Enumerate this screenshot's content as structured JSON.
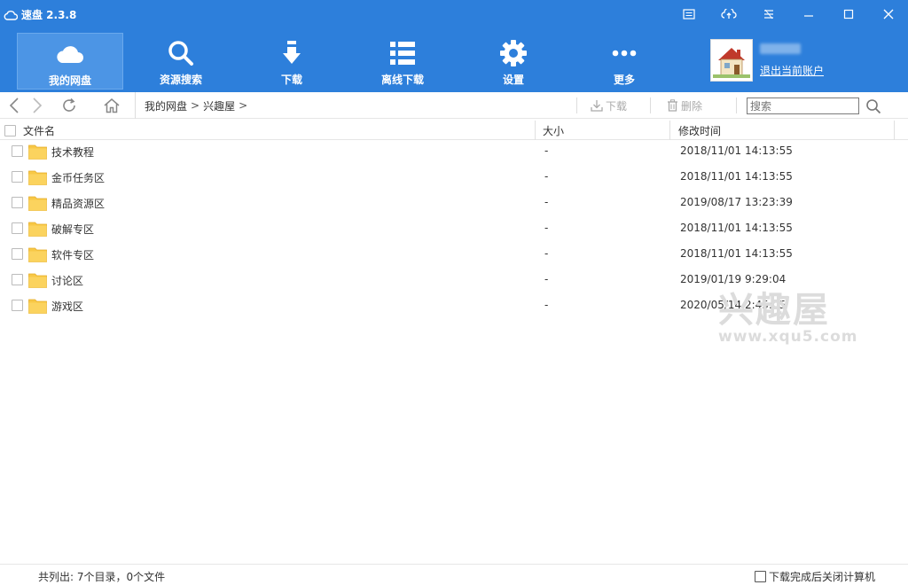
{
  "window": {
    "title": "速盘 2.3.8"
  },
  "nav": {
    "items": [
      {
        "label": "我的网盘",
        "icon": "cloud-icon",
        "active": true
      },
      {
        "label": "资源搜索",
        "icon": "search-icon",
        "active": false
      },
      {
        "label": "下载",
        "icon": "download-arrow-icon",
        "active": false
      },
      {
        "label": "离线下载",
        "icon": "list-icon",
        "active": false
      },
      {
        "label": "设置",
        "icon": "gear-icon",
        "active": false
      },
      {
        "label": "更多",
        "icon": "more-dots-icon",
        "active": false
      }
    ],
    "user": {
      "logout_label": "退出当前账户"
    }
  },
  "toolbar": {
    "breadcrumb": [
      "我的网盘",
      "兴趣屋"
    ],
    "breadcrumb_sep": ">",
    "download_label": "下载",
    "delete_label": "删除",
    "search_placeholder": "搜索"
  },
  "table": {
    "headers": {
      "name": "文件名",
      "size": "大小",
      "modified": "修改时间"
    },
    "rows": [
      {
        "name": "技术教程",
        "size": "-",
        "modified": "2018/11/01 14:13:55"
      },
      {
        "name": "金币任务区",
        "size": "-",
        "modified": "2018/11/01 14:13:55"
      },
      {
        "name": "精品资源区",
        "size": "-",
        "modified": "2019/08/17 13:23:39"
      },
      {
        "name": "破解专区",
        "size": "-",
        "modified": "2018/11/01 14:13:55"
      },
      {
        "name": "软件专区",
        "size": "-",
        "modified": "2018/11/01 14:13:55"
      },
      {
        "name": "讨论区",
        "size": "-",
        "modified": "2019/01/19 9:29:04"
      },
      {
        "name": "游戏区",
        "size": "-",
        "modified": "2020/05/14 2:45:05"
      }
    ]
  },
  "watermark": {
    "main": "兴趣屋",
    "sub": "www.xqu5.com"
  },
  "status": {
    "summary": "共列出: 7个目录，0个文件",
    "shutdown_label": "下载完成后关闭计算机"
  },
  "colors": {
    "brand_blue": "#2d7fdb",
    "active_tab": "#4c95e5",
    "folder_yellow": "#f8c846"
  }
}
